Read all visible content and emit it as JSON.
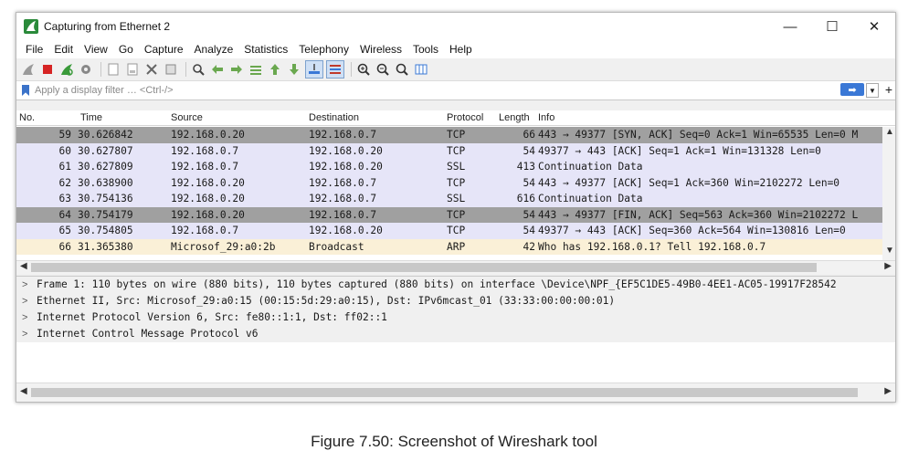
{
  "window": {
    "title": "Capturing from Ethernet 2",
    "controls": {
      "minimize": "—",
      "maximize": "☐",
      "close": "✕"
    }
  },
  "menu": [
    "File",
    "Edit",
    "View",
    "Go",
    "Capture",
    "Analyze",
    "Statistics",
    "Telephony",
    "Wireless",
    "Tools",
    "Help"
  ],
  "toolbar_icons": [
    "shark-fin-start-icon",
    "stop-icon",
    "restart-icon",
    "options-gear-icon",
    "open-file-icon",
    "save-file-icon",
    "close-file-icon",
    "reload-icon",
    "find-icon",
    "go-back-icon",
    "go-forward-icon",
    "go-to-packet-icon",
    "go-first-icon",
    "go-last-icon",
    "autoscroll-icon",
    "colorize-icon",
    "zoom-in-icon",
    "zoom-out-icon",
    "zoom-normal-icon",
    "resize-columns-icon"
  ],
  "filter": {
    "placeholder": "Apply a display filter … <Ctrl-/>",
    "apply_label": "➡",
    "add_label": "+"
  },
  "columns": {
    "no": "No.",
    "time": "Time",
    "source": "Source",
    "destination": "Destination",
    "protocol": "Protocol",
    "length": "Length",
    "info": "Info"
  },
  "packets": [
    {
      "no": "59",
      "time": "30.626842",
      "source": "192.168.0.20",
      "destination": "192.168.0.7",
      "protocol": "TCP",
      "length": "66",
      "info": "443 → 49377 [SYN, ACK] Seq=0 Ack=1 Win=65535 Len=0 M",
      "style": "dark"
    },
    {
      "no": "60",
      "time": "30.627807",
      "source": "192.168.0.7",
      "destination": "192.168.0.20",
      "protocol": "TCP",
      "length": "54",
      "info": "49377 → 443 [ACK] Seq=1 Ack=1 Win=131328 Len=0",
      "style": "tcp"
    },
    {
      "no": "61",
      "time": "30.627809",
      "source": "192.168.0.7",
      "destination": "192.168.0.20",
      "protocol": "SSL",
      "length": "413",
      "info": "Continuation Data",
      "style": "tcp"
    },
    {
      "no": "62",
      "time": "30.638900",
      "source": "192.168.0.20",
      "destination": "192.168.0.7",
      "protocol": "TCP",
      "length": "54",
      "info": "443 → 49377 [ACK] Seq=1 Ack=360 Win=2102272 Len=0",
      "style": "tcp"
    },
    {
      "no": "63",
      "time": "30.754136",
      "source": "192.168.0.20",
      "destination": "192.168.0.7",
      "protocol": "SSL",
      "length": "616",
      "info": "Continuation Data",
      "style": "tcp"
    },
    {
      "no": "64",
      "time": "30.754179",
      "source": "192.168.0.20",
      "destination": "192.168.0.7",
      "protocol": "TCP",
      "length": "54",
      "info": "443 → 49377 [FIN, ACK] Seq=563 Ack=360 Win=2102272 L",
      "style": "dark"
    },
    {
      "no": "65",
      "time": "30.754805",
      "source": "192.168.0.7",
      "destination": "192.168.0.20",
      "protocol": "TCP",
      "length": "54",
      "info": "49377 → 443 [ACK] Seq=360 Ack=564 Win=130816 Len=0",
      "style": "tcp"
    },
    {
      "no": "66",
      "time": "31.365380",
      "source": "Microsof_29:a0:2b",
      "destination": "Broadcast",
      "protocol": "ARP",
      "length": "42",
      "info": "Who has 192.168.0.1? Tell 192.168.0.7",
      "style": "arp"
    }
  ],
  "details": [
    "Frame 1: 110 bytes on wire (880 bits), 110 bytes captured (880 bits) on interface \\Device\\NPF_{EF5C1DE5-49B0-4EE1-AC05-19917F28542",
    "Ethernet II, Src: Microsof_29:a0:15 (00:15:5d:29:a0:15), Dst: IPv6mcast_01 (33:33:00:00:00:01)",
    "Internet Protocol Version 6, Src: fe80::1:1, Dst: ff02::1",
    "Internet Control Message Protocol v6"
  ],
  "caption": "Figure 7.50: Screenshot of Wireshark tool",
  "colors": {
    "tcp_row": "#e6e5f8",
    "dark_row": "#a0a0a0",
    "arp_row": "#faf0d7",
    "accent": "#3a78d6"
  }
}
